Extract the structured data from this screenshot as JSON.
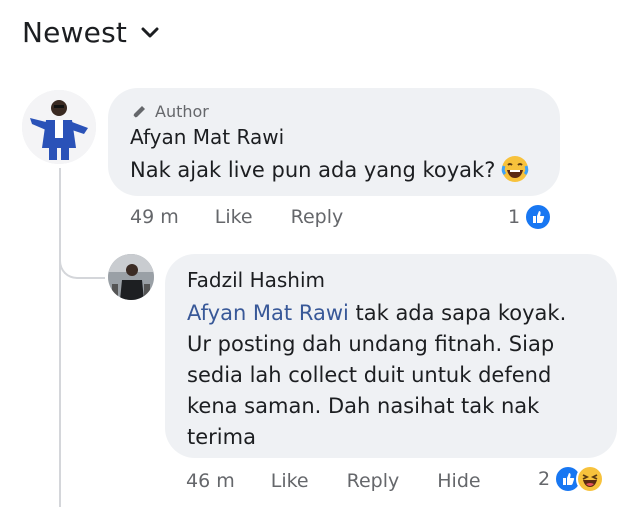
{
  "header": {
    "sort_label": "Newest"
  },
  "comments": [
    {
      "author_badge": "Author",
      "name": "Afyan Mat Rawi",
      "text": "Nak ajak live pun ada yang koyak?",
      "time": "49 m",
      "like_label": "Like",
      "reply_label": "Reply",
      "reaction_count": "1",
      "reactions": [
        "like-icon"
      ]
    }
  ],
  "replies": [
    {
      "name": "Fadzil Hashim",
      "mention": "Afyan Mat Rawi",
      "text": " tak ada sapa koyak. Ur posting dah undang fitnah.  Siap sedia lah collect duit untuk defend kena saman. Dah nasihat tak nak terima",
      "time": "46 m",
      "like_label": "Like",
      "reply_label": "Reply",
      "hide_label": "Hide",
      "reaction_count": "2",
      "reactions": [
        "like-icon",
        "haha-icon"
      ]
    }
  ],
  "colors": {
    "like_blue": "#1877f2",
    "mention": "#385898",
    "bubble": "#eff1f4",
    "meta": "#65676b"
  }
}
